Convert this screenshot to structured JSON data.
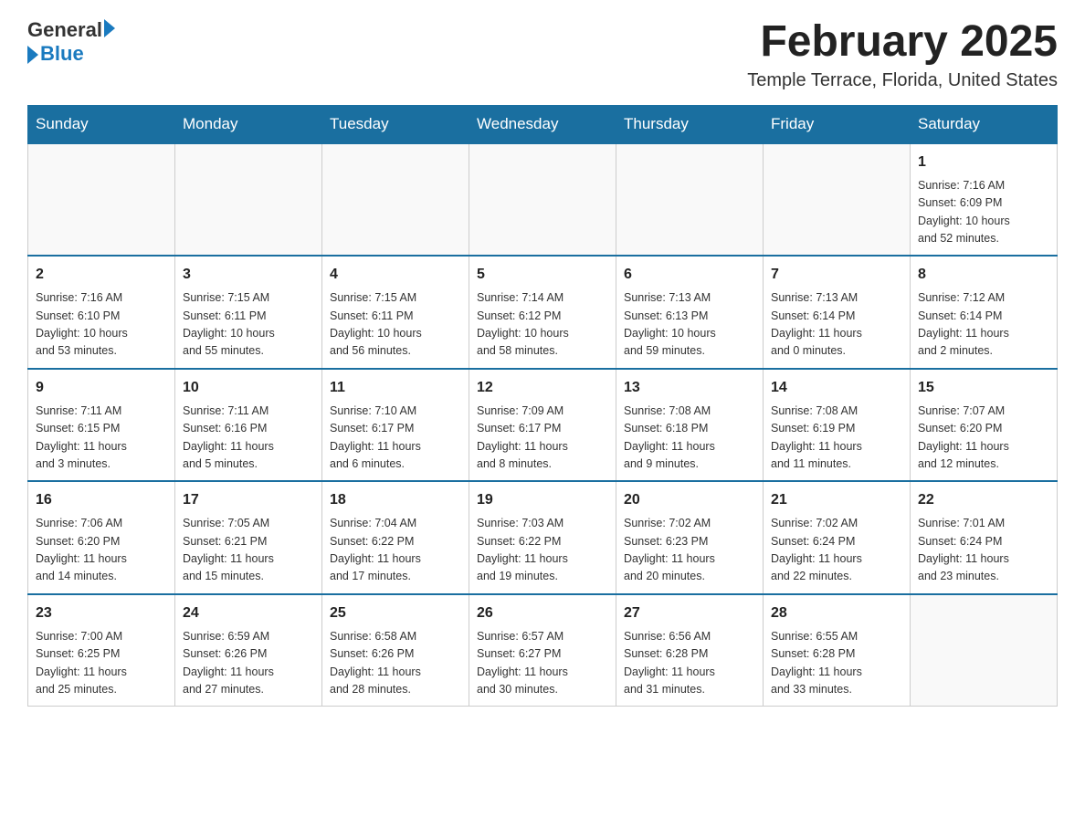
{
  "header": {
    "logo_text_main": "General",
    "logo_text_blue": "Blue",
    "title": "February 2025",
    "subtitle": "Temple Terrace, Florida, United States"
  },
  "weekdays": [
    "Sunday",
    "Monday",
    "Tuesday",
    "Wednesday",
    "Thursday",
    "Friday",
    "Saturday"
  ],
  "weeks": [
    [
      {
        "day": "",
        "info": ""
      },
      {
        "day": "",
        "info": ""
      },
      {
        "day": "",
        "info": ""
      },
      {
        "day": "",
        "info": ""
      },
      {
        "day": "",
        "info": ""
      },
      {
        "day": "",
        "info": ""
      },
      {
        "day": "1",
        "info": "Sunrise: 7:16 AM\nSunset: 6:09 PM\nDaylight: 10 hours\nand 52 minutes."
      }
    ],
    [
      {
        "day": "2",
        "info": "Sunrise: 7:16 AM\nSunset: 6:10 PM\nDaylight: 10 hours\nand 53 minutes."
      },
      {
        "day": "3",
        "info": "Sunrise: 7:15 AM\nSunset: 6:11 PM\nDaylight: 10 hours\nand 55 minutes."
      },
      {
        "day": "4",
        "info": "Sunrise: 7:15 AM\nSunset: 6:11 PM\nDaylight: 10 hours\nand 56 minutes."
      },
      {
        "day": "5",
        "info": "Sunrise: 7:14 AM\nSunset: 6:12 PM\nDaylight: 10 hours\nand 58 minutes."
      },
      {
        "day": "6",
        "info": "Sunrise: 7:13 AM\nSunset: 6:13 PM\nDaylight: 10 hours\nand 59 minutes."
      },
      {
        "day": "7",
        "info": "Sunrise: 7:13 AM\nSunset: 6:14 PM\nDaylight: 11 hours\nand 0 minutes."
      },
      {
        "day": "8",
        "info": "Sunrise: 7:12 AM\nSunset: 6:14 PM\nDaylight: 11 hours\nand 2 minutes."
      }
    ],
    [
      {
        "day": "9",
        "info": "Sunrise: 7:11 AM\nSunset: 6:15 PM\nDaylight: 11 hours\nand 3 minutes."
      },
      {
        "day": "10",
        "info": "Sunrise: 7:11 AM\nSunset: 6:16 PM\nDaylight: 11 hours\nand 5 minutes."
      },
      {
        "day": "11",
        "info": "Sunrise: 7:10 AM\nSunset: 6:17 PM\nDaylight: 11 hours\nand 6 minutes."
      },
      {
        "day": "12",
        "info": "Sunrise: 7:09 AM\nSunset: 6:17 PM\nDaylight: 11 hours\nand 8 minutes."
      },
      {
        "day": "13",
        "info": "Sunrise: 7:08 AM\nSunset: 6:18 PM\nDaylight: 11 hours\nand 9 minutes."
      },
      {
        "day": "14",
        "info": "Sunrise: 7:08 AM\nSunset: 6:19 PM\nDaylight: 11 hours\nand 11 minutes."
      },
      {
        "day": "15",
        "info": "Sunrise: 7:07 AM\nSunset: 6:20 PM\nDaylight: 11 hours\nand 12 minutes."
      }
    ],
    [
      {
        "day": "16",
        "info": "Sunrise: 7:06 AM\nSunset: 6:20 PM\nDaylight: 11 hours\nand 14 minutes."
      },
      {
        "day": "17",
        "info": "Sunrise: 7:05 AM\nSunset: 6:21 PM\nDaylight: 11 hours\nand 15 minutes."
      },
      {
        "day": "18",
        "info": "Sunrise: 7:04 AM\nSunset: 6:22 PM\nDaylight: 11 hours\nand 17 minutes."
      },
      {
        "day": "19",
        "info": "Sunrise: 7:03 AM\nSunset: 6:22 PM\nDaylight: 11 hours\nand 19 minutes."
      },
      {
        "day": "20",
        "info": "Sunrise: 7:02 AM\nSunset: 6:23 PM\nDaylight: 11 hours\nand 20 minutes."
      },
      {
        "day": "21",
        "info": "Sunrise: 7:02 AM\nSunset: 6:24 PM\nDaylight: 11 hours\nand 22 minutes."
      },
      {
        "day": "22",
        "info": "Sunrise: 7:01 AM\nSunset: 6:24 PM\nDaylight: 11 hours\nand 23 minutes."
      }
    ],
    [
      {
        "day": "23",
        "info": "Sunrise: 7:00 AM\nSunset: 6:25 PM\nDaylight: 11 hours\nand 25 minutes."
      },
      {
        "day": "24",
        "info": "Sunrise: 6:59 AM\nSunset: 6:26 PM\nDaylight: 11 hours\nand 27 minutes."
      },
      {
        "day": "25",
        "info": "Sunrise: 6:58 AM\nSunset: 6:26 PM\nDaylight: 11 hours\nand 28 minutes."
      },
      {
        "day": "26",
        "info": "Sunrise: 6:57 AM\nSunset: 6:27 PM\nDaylight: 11 hours\nand 30 minutes."
      },
      {
        "day": "27",
        "info": "Sunrise: 6:56 AM\nSunset: 6:28 PM\nDaylight: 11 hours\nand 31 minutes."
      },
      {
        "day": "28",
        "info": "Sunrise: 6:55 AM\nSunset: 6:28 PM\nDaylight: 11 hours\nand 33 minutes."
      },
      {
        "day": "",
        "info": ""
      }
    ]
  ]
}
